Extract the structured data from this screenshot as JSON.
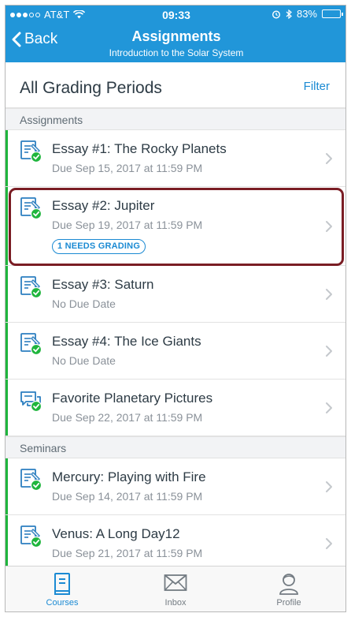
{
  "status_bar": {
    "carrier": "AT&T",
    "time": "09:33",
    "battery": "83%",
    "battery_level": 0.83
  },
  "nav": {
    "back_label": "Back",
    "title": "Assignments",
    "subtitle": "Introduction to the Solar System"
  },
  "page": {
    "title": "All Grading Periods",
    "filter_label": "Filter"
  },
  "sections": [
    {
      "header": "Assignments",
      "items": [
        {
          "title": "Essay #1: The Rocky Planets",
          "subtitle": "Due Sep 15, 2017 at 11:59 PM",
          "icon": "assignment-published-icon"
        },
        {
          "title": "Essay #2: Jupiter",
          "subtitle": "Due Sep 19, 2017 at 11:59 PM",
          "badge": "1 NEEDS GRADING",
          "icon": "assignment-published-icon"
        },
        {
          "title": "Essay #3: Saturn",
          "subtitle": "No Due Date",
          "icon": "assignment-published-icon"
        },
        {
          "title": "Essay #4: The Ice Giants",
          "subtitle": "No Due Date",
          "icon": "assignment-published-icon"
        },
        {
          "title": "Favorite Planetary Pictures",
          "subtitle": "Due Sep 22, 2017 at 11:59 PM",
          "icon": "discussion-published-icon"
        }
      ]
    },
    {
      "header": "Seminars",
      "items": [
        {
          "title": "Mercury: Playing with Fire",
          "subtitle": "Due Sep 14, 2017 at 11:59 PM",
          "icon": "assignment-published-icon"
        },
        {
          "title": "Venus: A Long Day12",
          "subtitle": "Due Sep 21, 2017 at 11:59 PM",
          "icon": "assignment-published-icon"
        }
      ]
    }
  ],
  "tabs": [
    {
      "label": "Courses",
      "icon": "courses-icon",
      "active": true
    },
    {
      "label": "Inbox",
      "icon": "inbox-icon",
      "active": false
    },
    {
      "label": "Profile",
      "icon": "profile-icon",
      "active": false
    }
  ],
  "colors": {
    "brand": "#2196d9",
    "published": "#1fb53d",
    "link": "#1b8ad3",
    "highlight": "#7a1d24"
  }
}
